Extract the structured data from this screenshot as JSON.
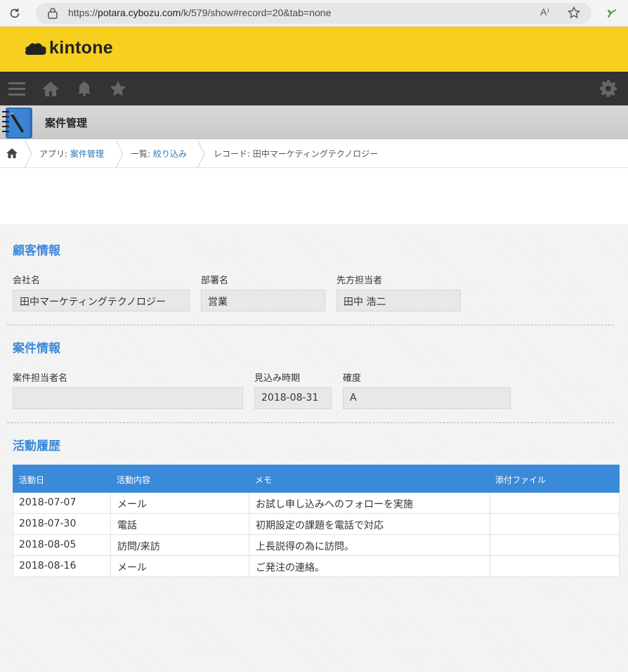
{
  "browser": {
    "url_prefix": "https://",
    "url_host": "potara.cybozu.com",
    "url_path": "/k/579/show#record=20&tab=none",
    "read_aloud_label": "A⁾"
  },
  "header": {
    "logo_text": "kintone",
    "accent": "#f7cf1e",
    "nav_bg": "#333333"
  },
  "app": {
    "name": "案件管理"
  },
  "breadcrumb": {
    "app_prefix": "アプリ: ",
    "app_link": "案件管理",
    "list_prefix": "一覧: ",
    "list_link": "絞り込み",
    "record_label": "レコード: 田中マーケティングテクノロジー"
  },
  "customer": {
    "title": "顧客情報",
    "company_label": "会社名",
    "company_value": "田中マーケティングテクノロジー",
    "dept_label": "部署名",
    "dept_value": "営業",
    "contact_label": "先方担当者",
    "contact_value": "田中 浩二"
  },
  "deal": {
    "title": "案件情報",
    "owner_label": "案件担当者名",
    "owner_value": "",
    "expected_label": "見込み時期",
    "expected_value": "2018-08-31",
    "certainty_label": "確度",
    "certainty_value": "A"
  },
  "activity": {
    "title": "活動履歴",
    "columns": [
      "活動日",
      "活動内容",
      "メモ",
      "添付ファイル"
    ],
    "rows": [
      {
        "date": "2018-07-07",
        "type": "メール",
        "memo": "お試し申し込みへのフォローを実施",
        "file": ""
      },
      {
        "date": "2018-07-30",
        "type": "電話",
        "memo": "初期設定の課題を電話で対応",
        "file": ""
      },
      {
        "date": "2018-08-05",
        "type": "訪問/来訪",
        "memo": "上長説得の為に訪問。",
        "file": ""
      },
      {
        "date": "2018-08-16",
        "type": "メール",
        "memo": "ご発注の連絡。",
        "file": ""
      }
    ],
    "header_color": "#3b8ad9"
  }
}
